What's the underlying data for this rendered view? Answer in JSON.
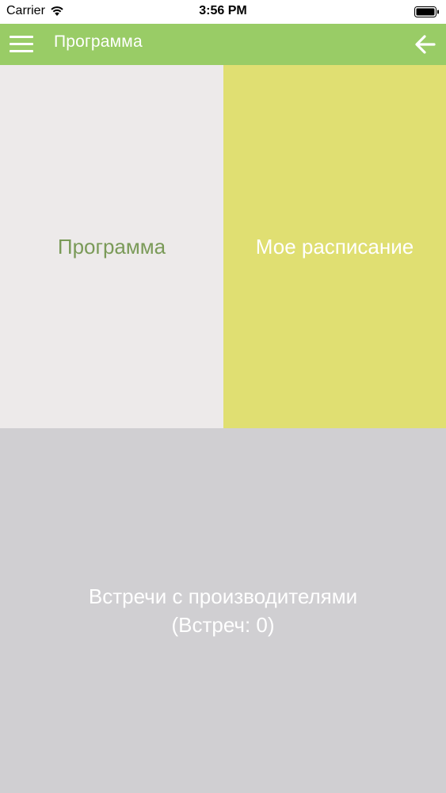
{
  "status_bar": {
    "carrier": "Carrier",
    "time": "3:56 PM",
    "wifi_icon": "wifi-icon",
    "battery_icon": "battery-icon"
  },
  "navbar": {
    "title": "Программа",
    "menu_icon": "hamburger-menu-icon",
    "back_icon": "arrow-left-icon",
    "background": "#99cc66"
  },
  "tiles": {
    "program": {
      "label": "Программа",
      "background": "#edeaea",
      "text_color": "#7a9a58"
    },
    "schedule": {
      "label": "Мое расписание",
      "background": "#e0df72",
      "text_color": "#ffffff"
    },
    "meetings": {
      "label": "Встречи с производителями",
      "count_label": "(Встреч: 0)",
      "background": "#d0cfd2",
      "text_color": "#ffffff"
    }
  }
}
